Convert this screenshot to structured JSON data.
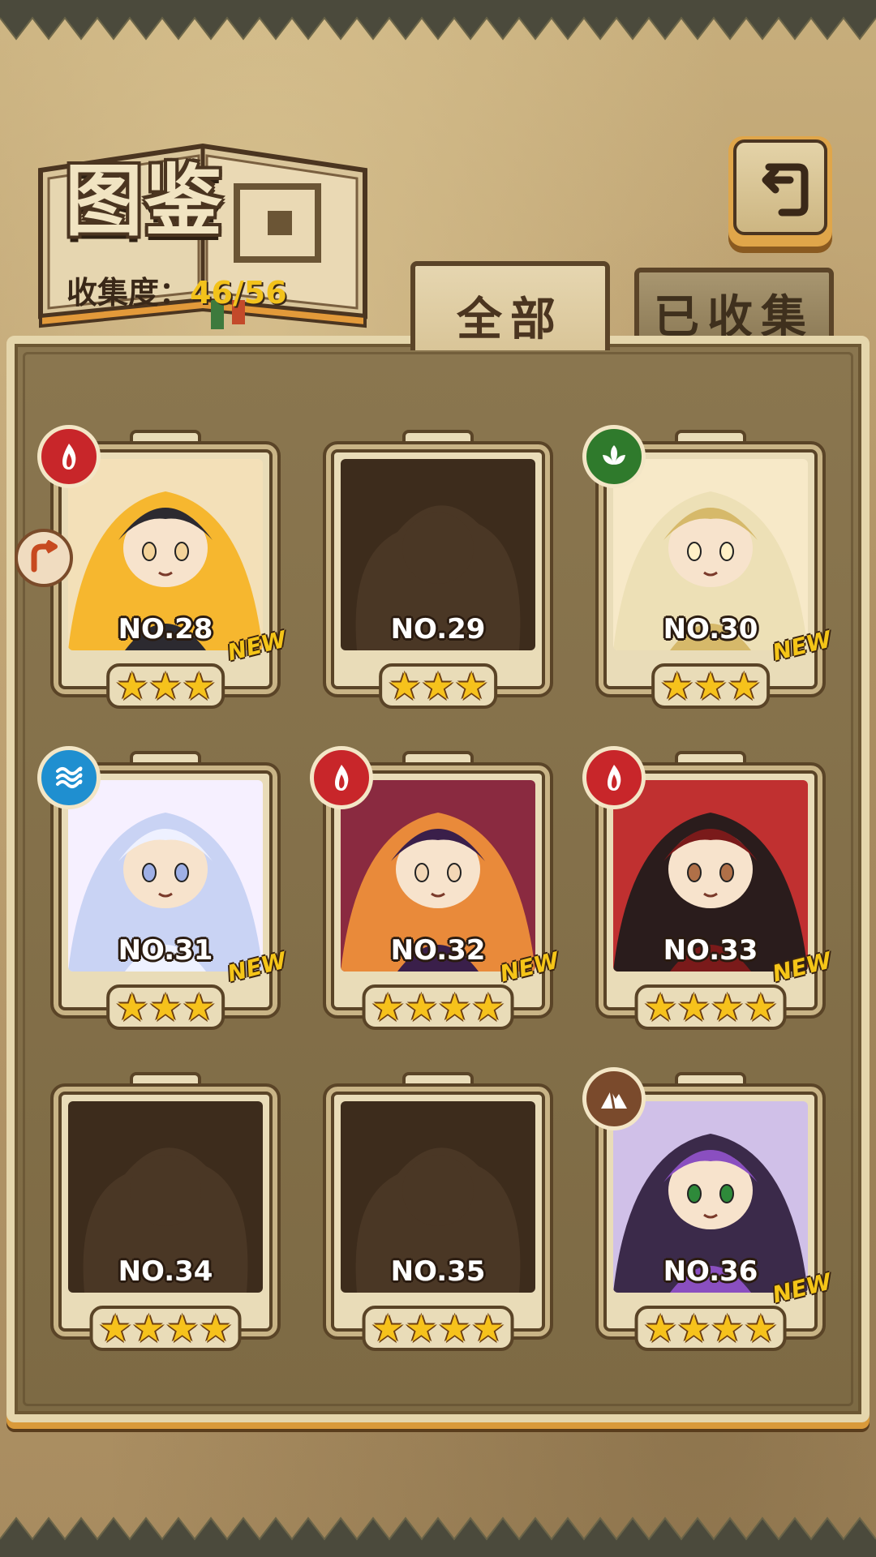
{
  "header": {
    "title": "图鉴",
    "collection_label": "收集度：",
    "collection_value": "46/56"
  },
  "tabs": [
    {
      "label": "全部",
      "active": true
    },
    {
      "label": "已收集",
      "active": false
    }
  ],
  "colors": {
    "fire": "#c8262a",
    "wood": "#2f7a2c",
    "water": "#1f8fd0",
    "earth": "#7a4a2c",
    "star": "#f6c21c",
    "new_badge": "#f5c518",
    "collection_value": "#f3c21b"
  },
  "cards": [
    {
      "no": "NO.28",
      "element": "fire",
      "element_icon": "fire-icon",
      "stars": "★★★",
      "star_count": 3,
      "new": "NEW",
      "collected": true
    },
    {
      "no": "NO.29",
      "element": "",
      "element_icon": "",
      "stars": "★★★",
      "star_count": 3,
      "new": "",
      "collected": false
    },
    {
      "no": "NO.30",
      "element": "wood",
      "element_icon": "leaf-icon",
      "stars": "★★★",
      "star_count": 3,
      "new": "NEW",
      "collected": true
    },
    {
      "no": "NO.31",
      "element": "water",
      "element_icon": "water-icon",
      "stars": "★★★",
      "star_count": 3,
      "new": "NEW",
      "collected": true
    },
    {
      "no": "NO.32",
      "element": "fire",
      "element_icon": "fire-icon",
      "stars": "★★★★",
      "star_count": 4,
      "new": "NEW",
      "collected": true
    },
    {
      "no": "NO.33",
      "element": "fire",
      "element_icon": "fire-icon",
      "stars": "★★★★",
      "star_count": 4,
      "new": "NEW",
      "collected": true
    },
    {
      "no": "NO.34",
      "element": "",
      "element_icon": "",
      "stars": "★★★★",
      "star_count": 4,
      "new": "",
      "collected": false
    },
    {
      "no": "NO.35",
      "element": "",
      "element_icon": "",
      "stars": "★★★★",
      "star_count": 4,
      "new": "",
      "collected": false
    },
    {
      "no": "NO.36",
      "element": "earth",
      "element_icon": "mountain-icon",
      "stars": "★★★★",
      "star_count": 4,
      "new": "NEW",
      "collected": true
    }
  ]
}
